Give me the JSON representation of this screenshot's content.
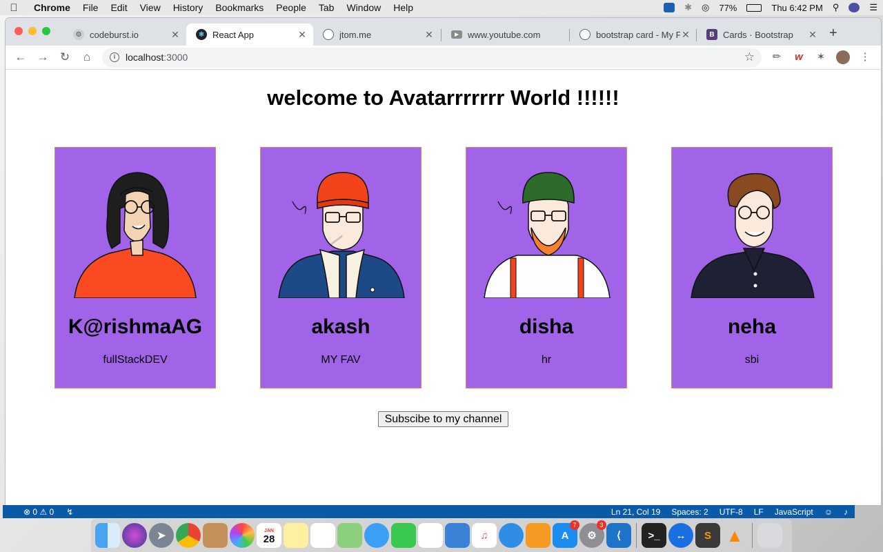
{
  "menubar": {
    "app": "Chrome",
    "items": [
      "File",
      "Edit",
      "View",
      "History",
      "Bookmarks",
      "People",
      "Tab",
      "Window",
      "Help"
    ],
    "battery": "77%",
    "clock": "Thu 6:42 PM"
  },
  "browser": {
    "tabs": [
      {
        "title": "codeburst.io",
        "icon": "codeburst-icon"
      },
      {
        "title": "React App",
        "icon": "react-icon"
      },
      {
        "title": "jtom.me",
        "icon": "globe-icon"
      },
      {
        "title": "www.youtube.com",
        "icon": "youtube-icon"
      },
      {
        "title": "bootstrap card - My F",
        "icon": "globe-icon"
      },
      {
        "title": "Cards · Bootstrap",
        "icon": "bootstrap-icon"
      }
    ],
    "url_host": "localhost",
    "url_port": ":3000"
  },
  "page": {
    "heading": "welcome to Avatarrrrrrr World !!!!!!",
    "cards": [
      {
        "name": "K@rishmaAG",
        "role": "fullStackDEV"
      },
      {
        "name": "akash",
        "role": "MY FAV"
      },
      {
        "name": "disha",
        "role": "hr"
      },
      {
        "name": "neha",
        "role": "sbi"
      }
    ],
    "subscribe_label": "Subscibe to my channel"
  },
  "statusbar": {
    "errors": "0",
    "warnings": "0",
    "position": "Ln 21, Col 19",
    "spaces": "Spaces: 2",
    "encoding": "UTF-8",
    "eol": "LF",
    "language": "JavaScript"
  },
  "dock": {
    "calendar_month": "JAN",
    "calendar_day": "28",
    "appstore_badge": "7",
    "settings_badge": "3"
  }
}
